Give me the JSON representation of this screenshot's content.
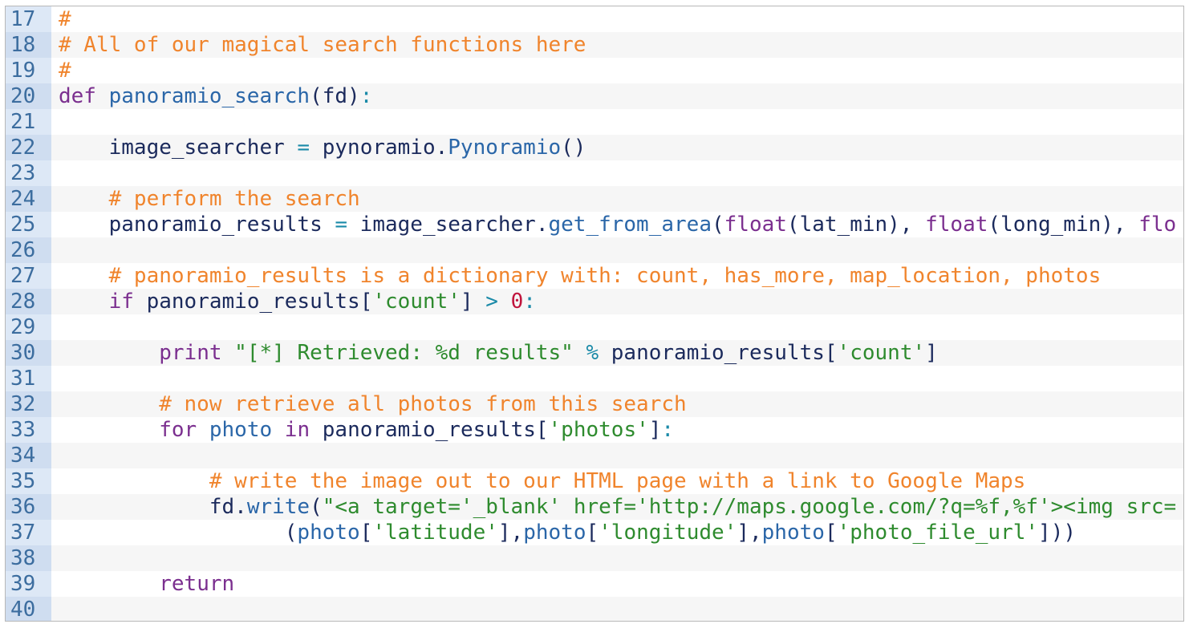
{
  "editor": {
    "lines": [
      {
        "num": "17",
        "tokens": [
          {
            "t": "#",
            "k": "c"
          }
        ]
      },
      {
        "num": "18",
        "tokens": [
          {
            "t": "# All of our magical search functions here",
            "k": "c"
          }
        ]
      },
      {
        "num": "19",
        "tokens": [
          {
            "t": "#",
            "k": "c"
          }
        ]
      },
      {
        "num": "20",
        "tokens": [
          {
            "t": "def",
            "k": "k"
          },
          {
            "t": " ",
            "k": "t"
          },
          {
            "t": "panoramio_search",
            "k": "f"
          },
          {
            "t": "(fd)",
            "k": "t"
          },
          {
            "t": ":",
            "k": "o"
          }
        ]
      },
      {
        "num": "21",
        "tokens": []
      },
      {
        "num": "22",
        "tokens": [
          {
            "t": "    image_searcher ",
            "k": "t"
          },
          {
            "t": "=",
            "k": "o"
          },
          {
            "t": " pynoramio.",
            "k": "t"
          },
          {
            "t": "Pynoramio",
            "k": "f"
          },
          {
            "t": "()",
            "k": "t"
          }
        ]
      },
      {
        "num": "23",
        "tokens": []
      },
      {
        "num": "24",
        "tokens": [
          {
            "t": "    # perform the search",
            "k": "c"
          }
        ]
      },
      {
        "num": "25",
        "tokens": [
          {
            "t": "    panoramio_results ",
            "k": "t"
          },
          {
            "t": "=",
            "k": "o"
          },
          {
            "t": " image_searcher.",
            "k": "t"
          },
          {
            "t": "get_from_area",
            "k": "f"
          },
          {
            "t": "(",
            "k": "t"
          },
          {
            "t": "float",
            "k": "k"
          },
          {
            "t": "(lat_min), ",
            "k": "t"
          },
          {
            "t": "float",
            "k": "k"
          },
          {
            "t": "(long_min), ",
            "k": "t"
          },
          {
            "t": "flo",
            "k": "k"
          }
        ]
      },
      {
        "num": "26",
        "tokens": []
      },
      {
        "num": "27",
        "tokens": [
          {
            "t": "    # panoramio_results is a dictionary with: count, has_more, map_location, photos",
            "k": "c"
          }
        ]
      },
      {
        "num": "28",
        "tokens": [
          {
            "t": "    ",
            "k": "t"
          },
          {
            "t": "if",
            "k": "k"
          },
          {
            "t": " panoramio_results[",
            "k": "t"
          },
          {
            "t": "'count'",
            "k": "s"
          },
          {
            "t": "] ",
            "k": "t"
          },
          {
            "t": ">",
            "k": "o"
          },
          {
            "t": " ",
            "k": "t"
          },
          {
            "t": "0",
            "k": "n"
          },
          {
            "t": ":",
            "k": "o"
          }
        ]
      },
      {
        "num": "29",
        "tokens": []
      },
      {
        "num": "30",
        "tokens": [
          {
            "t": "        ",
            "k": "t"
          },
          {
            "t": "print",
            "k": "k"
          },
          {
            "t": " ",
            "k": "t"
          },
          {
            "t": "\"[*] Retrieved: %d results\"",
            "k": "s"
          },
          {
            "t": " ",
            "k": "t"
          },
          {
            "t": "%",
            "k": "o"
          },
          {
            "t": " panoramio_results[",
            "k": "t"
          },
          {
            "t": "'count'",
            "k": "s"
          },
          {
            "t": "]",
            "k": "t"
          }
        ]
      },
      {
        "num": "31",
        "tokens": []
      },
      {
        "num": "32",
        "tokens": [
          {
            "t": "        # now retrieve all photos from this search",
            "k": "c"
          }
        ]
      },
      {
        "num": "33",
        "tokens": [
          {
            "t": "        ",
            "k": "t"
          },
          {
            "t": "for",
            "k": "k"
          },
          {
            "t": " ",
            "k": "t"
          },
          {
            "t": "photo",
            "k": "f"
          },
          {
            "t": " ",
            "k": "t"
          },
          {
            "t": "in",
            "k": "k"
          },
          {
            "t": " panoramio_results[",
            "k": "t"
          },
          {
            "t": "'photos'",
            "k": "s"
          },
          {
            "t": "]",
            "k": "t"
          },
          {
            "t": ":",
            "k": "o"
          }
        ]
      },
      {
        "num": "34",
        "tokens": []
      },
      {
        "num": "35",
        "tokens": [
          {
            "t": "            # write the image out to our HTML page with a link to Google Maps",
            "k": "c"
          }
        ]
      },
      {
        "num": "36",
        "tokens": [
          {
            "t": "            fd.",
            "k": "t"
          },
          {
            "t": "write",
            "k": "f"
          },
          {
            "t": "(",
            "k": "t"
          },
          {
            "t": "\"<a target='_blank' href='http://maps.google.com/?q=%f,%f'><img src=",
            "k": "s"
          }
        ]
      },
      {
        "num": "37",
        "tokens": [
          {
            "t": "                  (",
            "k": "t"
          },
          {
            "t": "photo",
            "k": "f"
          },
          {
            "t": "[",
            "k": "t"
          },
          {
            "t": "'latitude'",
            "k": "s"
          },
          {
            "t": "],",
            "k": "t"
          },
          {
            "t": "photo",
            "k": "f"
          },
          {
            "t": "[",
            "k": "t"
          },
          {
            "t": "'longitude'",
            "k": "s"
          },
          {
            "t": "],",
            "k": "t"
          },
          {
            "t": "photo",
            "k": "f"
          },
          {
            "t": "[",
            "k": "t"
          },
          {
            "t": "'photo_file_url'",
            "k": "s"
          },
          {
            "t": "]))",
            "k": "t"
          }
        ]
      },
      {
        "num": "38",
        "tokens": []
      },
      {
        "num": "39",
        "tokens": [
          {
            "t": "        ",
            "k": "t"
          },
          {
            "t": "return",
            "k": "k"
          }
        ]
      },
      {
        "num": "40",
        "tokens": []
      }
    ]
  }
}
